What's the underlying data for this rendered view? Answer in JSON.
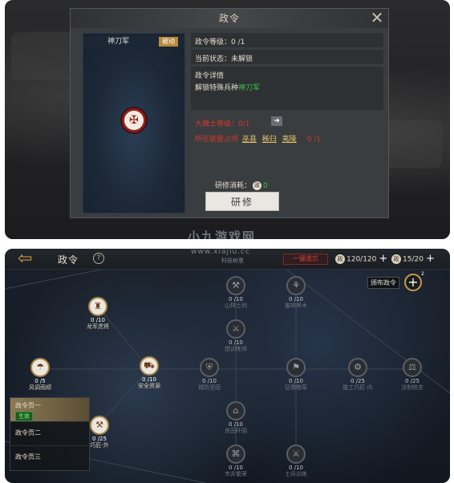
{
  "top_dialog": {
    "title": "政令",
    "card_name": "神刀军",
    "card_tag": "被动",
    "level_label": "政令等级：0 /1",
    "status_label": "当前状态：未解锁",
    "detail_title": "政令详情",
    "detail_text": "解锁特殊兵种",
    "detail_highlight": "神刀军",
    "req_level": "大魏士等级：0/1",
    "req_alliance_prefix": "所在联盟占领",
    "req_places": [
      "巫县",
      "秭归",
      "夷陵"
    ],
    "req_count": "0 /1",
    "cost_label": "研修消耗：",
    "cost_icon": "政",
    "cost_value": "0",
    "study_button": "研修",
    "watermark": "小九游戏网"
  },
  "bottom": {
    "page_title": "政令",
    "watermark": "www.xiajiu.cc",
    "watermark_sub": "科技树恩",
    "oneclick_label": "一键遗忘",
    "res1_icon": "政",
    "res1_value": "120/120",
    "res2_icon": "政",
    "res2_value": "15/20",
    "order_label": "颁布政令",
    "order_sup": "2",
    "nodes": [
      {
        "id": "a",
        "lvl": "0 /10",
        "name": "山林土利"
      },
      {
        "id": "b",
        "lvl": "0 /10",
        "name": "畜林养木"
      },
      {
        "id": "c",
        "lvl": "0 /10",
        "name": "龙军虎将"
      },
      {
        "id": "d",
        "lvl": "0 /10",
        "name": "措训练师"
      },
      {
        "id": "e",
        "lvl": "0 /5",
        "name": "风调雨顺"
      },
      {
        "id": "f",
        "lvl": "0 /10",
        "name": "安全资源"
      },
      {
        "id": "g",
        "lvl": "0 /10",
        "name": "城防坚固"
      },
      {
        "id": "h",
        "lvl": "0 /10",
        "name": "征缴粮草"
      },
      {
        "id": "i",
        "lvl": "0 /25",
        "name": "能工巧匠·内"
      },
      {
        "id": "j",
        "lvl": "0 /25",
        "name": "法制统言"
      },
      {
        "id": "k",
        "lvl": "0 /10",
        "name": "良田阡陌"
      },
      {
        "id": "l",
        "lvl": "0 /25",
        "name": "巧匠·外"
      },
      {
        "id": "m",
        "lvl": "0 /10",
        "name": "市井繁荣"
      },
      {
        "id": "n",
        "lvl": "0 /10",
        "name": "士兵训练"
      }
    ],
    "pages": [
      {
        "label": "政令页一",
        "status": "生效"
      },
      {
        "label": "政令页二"
      },
      {
        "label": "政令页三"
      }
    ]
  },
  "colors": {
    "accent_gold": "#c49a4a",
    "active_green": "#39c24a",
    "warn_red": "#d0382c"
  }
}
